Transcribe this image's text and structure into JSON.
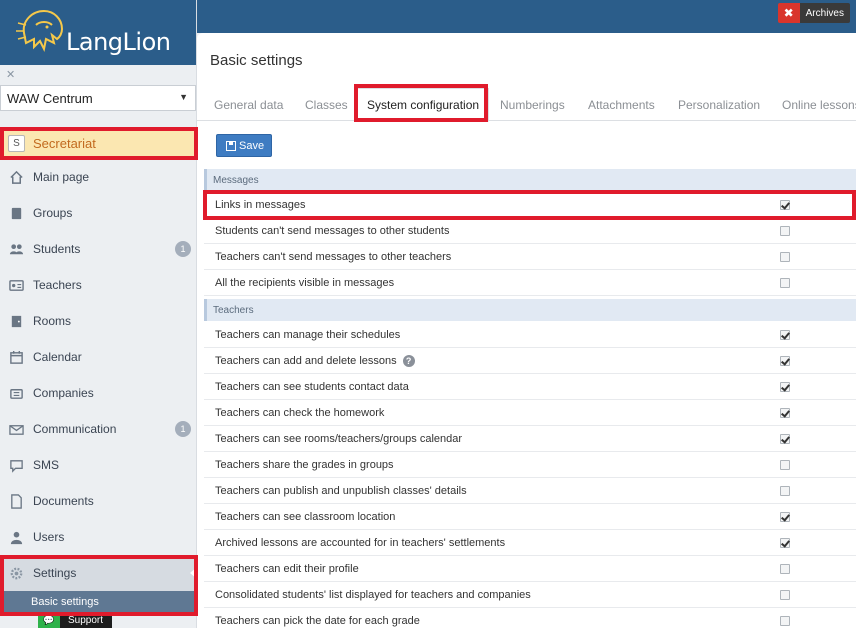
{
  "brand": {
    "logo_text": "LangLion"
  },
  "topbar": {
    "archives_label": "Archives"
  },
  "branch": {
    "selected": "WAW Centrum"
  },
  "secretariat": {
    "badge": "S",
    "label": "Secretariat"
  },
  "nav": [
    {
      "label": "Main page",
      "icon": "home-icon"
    },
    {
      "label": "Groups",
      "icon": "book-icon"
    },
    {
      "label": "Students",
      "icon": "users-icon",
      "count": "1"
    },
    {
      "label": "Teachers",
      "icon": "id-card-icon"
    },
    {
      "label": "Rooms",
      "icon": "door-icon"
    },
    {
      "label": "Calendar",
      "icon": "calendar-icon"
    },
    {
      "label": "Companies",
      "icon": "building-icon"
    },
    {
      "label": "Communication",
      "icon": "envelope-icon",
      "count": "1"
    },
    {
      "label": "SMS",
      "icon": "chat-icon"
    },
    {
      "label": "Documents",
      "icon": "document-icon"
    },
    {
      "label": "Users",
      "icon": "user-icon"
    },
    {
      "label": "Settings",
      "icon": "gear-icon"
    }
  ],
  "subnav": {
    "basic_settings": "Basic settings"
  },
  "support": {
    "label": "Support"
  },
  "main": {
    "title": "Basic settings",
    "tabs": [
      "General data",
      "Classes",
      "System configuration",
      "Numberings",
      "Attachments",
      "Personalization",
      "Online lessons"
    ],
    "active_tab": "System configuration",
    "save_label": "Save"
  },
  "sections": {
    "messages": {
      "title": "Messages",
      "rows": [
        {
          "label": "Links in messages",
          "checked": true
        },
        {
          "label": "Students can't send messages to other students",
          "checked": false
        },
        {
          "label": "Teachers can't send messages to other teachers",
          "checked": false
        },
        {
          "label": "All the recipients visible in messages",
          "checked": false
        }
      ]
    },
    "teachers": {
      "title": "Teachers",
      "rows": [
        {
          "label": "Teachers can manage their schedules",
          "checked": true
        },
        {
          "label": "Teachers can add and delete lessons",
          "checked": true,
          "help": "?"
        },
        {
          "label": "Teachers can see students contact data",
          "checked": true
        },
        {
          "label": "Teachers can check the homework",
          "checked": true
        },
        {
          "label": "Teachers can see rooms/teachers/groups calendar",
          "checked": true
        },
        {
          "label": "Teachers share the grades in groups",
          "checked": false
        },
        {
          "label": "Teachers can publish and unpublish classes' details",
          "checked": false
        },
        {
          "label": "Teachers can see classroom location",
          "checked": true
        },
        {
          "label": "Archived lessons are accounted for in teachers' settlements",
          "checked": true
        },
        {
          "label": "Teachers can edit their profile",
          "checked": false
        },
        {
          "label": "Consolidated students' list displayed for teachers and companies",
          "checked": false
        },
        {
          "label": "Teachers can pick the date for each grade",
          "checked": false
        }
      ]
    }
  }
}
